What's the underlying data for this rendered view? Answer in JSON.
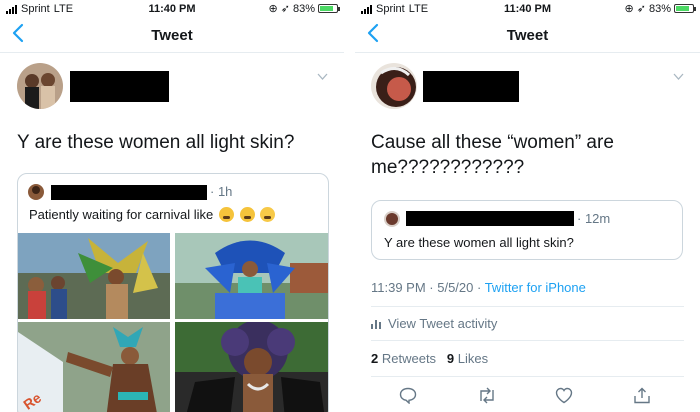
{
  "status_bar": {
    "carrier": "Sprint",
    "network": "LTE",
    "time": "11:40 PM",
    "battery": "83%",
    "battery_level": 0.83
  },
  "nav": {
    "back_icon": "chevron-left-icon",
    "title": "Tweet"
  },
  "left": {
    "tweet_text": "Y are these women all light skin?",
    "quote": {
      "time": "1h",
      "text": "Patiently waiting for carnival like"
    }
  },
  "right": {
    "tweet_text": "Cause all these “women” are me????????????",
    "quote": {
      "time": "12m",
      "text": "Y are these women all light skin?"
    },
    "timestamp": "11:39 PM · 5/5/20 · ",
    "source": "Twitter for iPhone",
    "activity": "View Tweet activity",
    "retweets_count": "2",
    "retweets_label": "Retweets",
    "likes_count": "9",
    "likes_label": "Likes"
  },
  "colors": {
    "accent": "#1da1f2",
    "muted": "#657786",
    "border": "#e6ecf0"
  }
}
